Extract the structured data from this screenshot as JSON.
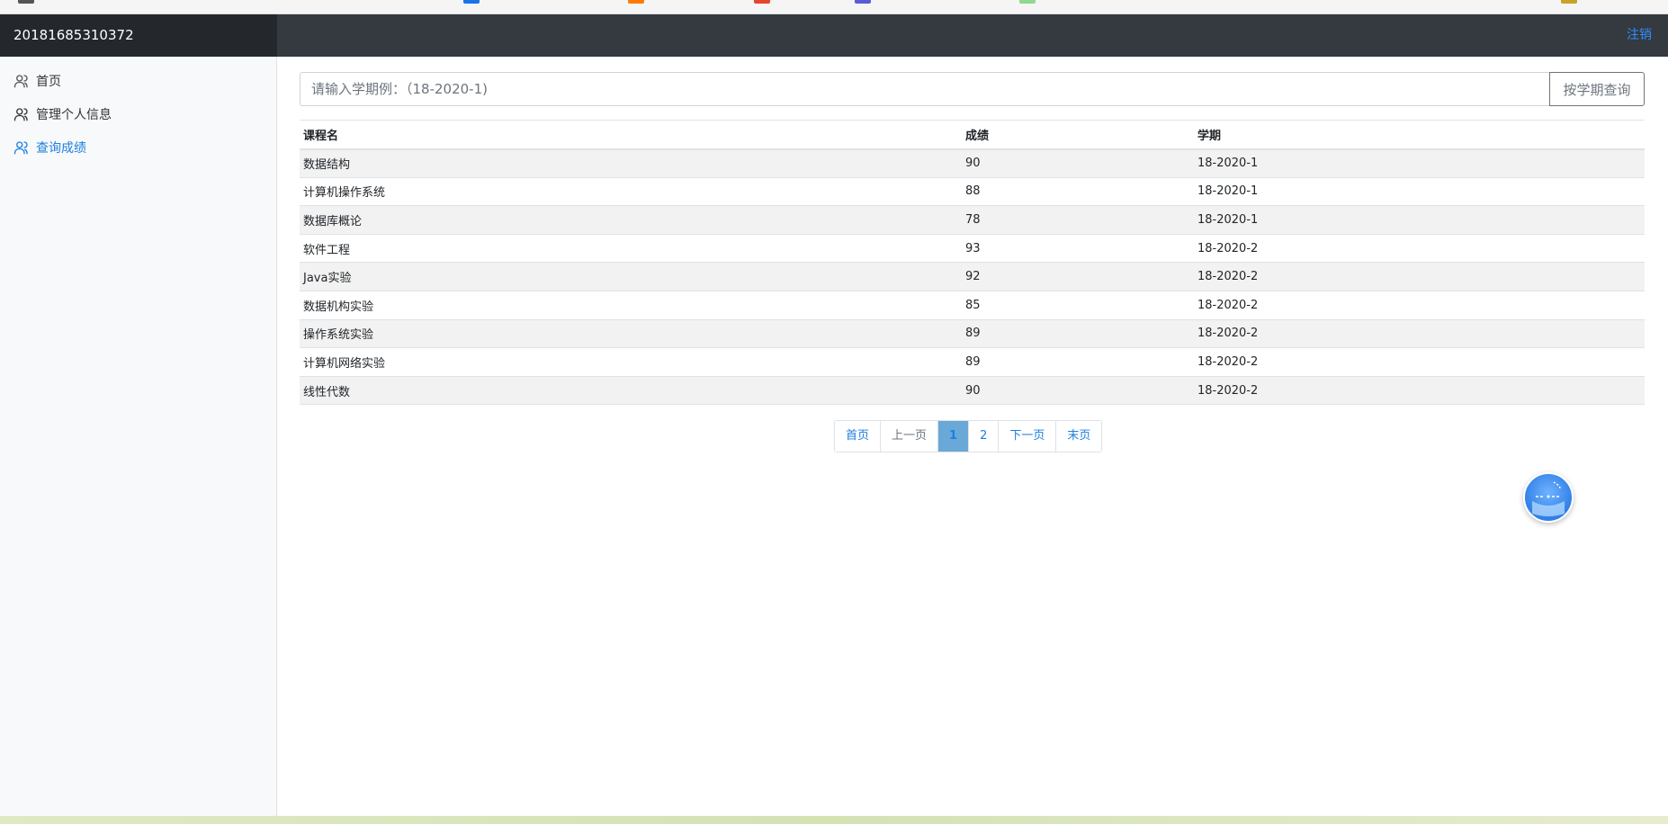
{
  "navbar": {
    "brand": "20181685310372",
    "logout_label": "注销"
  },
  "sidebar": {
    "items": [
      {
        "label": "首页",
        "icon": "users-icon",
        "active": false
      },
      {
        "label": "管理个人信息",
        "icon": "users-icon",
        "active": false
      },
      {
        "label": "查询成绩",
        "icon": "users-icon",
        "active": true
      }
    ]
  },
  "search": {
    "placeholder": "请输入学期例：（18-2020-1)",
    "button_label": "按学期查询"
  },
  "table": {
    "headers": [
      "课程名",
      "成绩",
      "学期"
    ],
    "rows": [
      [
        "数据结构",
        "90",
        "18-2020-1"
      ],
      [
        "计算机操作系统",
        "88",
        "18-2020-1"
      ],
      [
        "数据库概论",
        "78",
        "18-2020-1"
      ],
      [
        "软件工程",
        "93",
        "18-2020-2"
      ],
      [
        "Java实验",
        "92",
        "18-2020-2"
      ],
      [
        "数据机构实验",
        "85",
        "18-2020-2"
      ],
      [
        "操作系统实验",
        "89",
        "18-2020-2"
      ],
      [
        "计算机网络实验",
        "89",
        "18-2020-2"
      ],
      [
        "线性代数",
        "90",
        "18-2020-2"
      ]
    ]
  },
  "pagination": {
    "first": "首页",
    "prev": "上一页",
    "pages": [
      "1",
      "2"
    ],
    "current_page": "1",
    "next": "下一页",
    "last": "末页"
  },
  "colors": {
    "navbar_bg": "#343a40",
    "brand_bg": "#24282c",
    "accent": "#1b7fe0",
    "active_page_bg": "#6aa8d8"
  }
}
